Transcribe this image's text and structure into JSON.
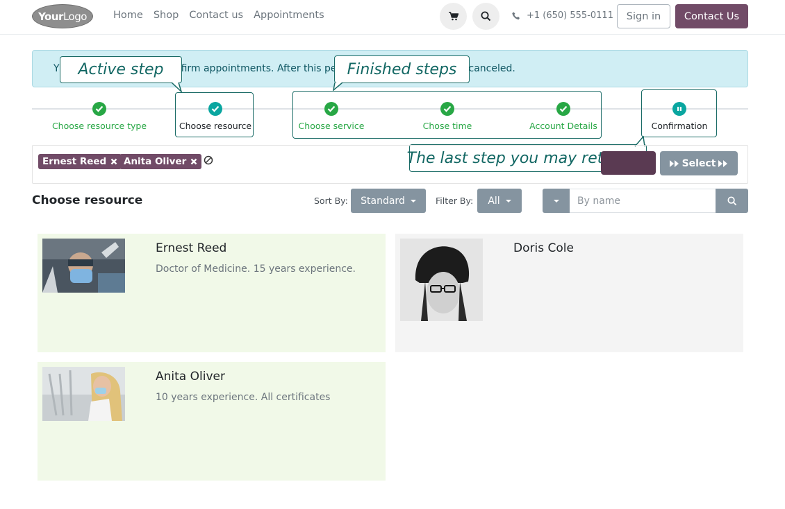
{
  "header": {
    "logo": {
      "part1": "Your",
      "part2": "Logo"
    },
    "nav": [
      "Home",
      "Shop",
      "Contact us",
      "Appointments"
    ],
    "phone": "+1 (650) 555-0111",
    "sign_in": "Sign in",
    "contact_us": "Contact Us",
    "icons": [
      "cart-icon",
      "search-icon",
      "phone-icon"
    ]
  },
  "alert": {
    "text_start": "Y",
    "text_mid": "firm appointments. After this pe",
    "text_end": "canceled."
  },
  "steps": [
    {
      "label": "Choose resource type",
      "state": "done"
    },
    {
      "label": "Choose resource",
      "state": "active"
    },
    {
      "label": "Choose service",
      "state": "done"
    },
    {
      "label": "Chose time",
      "state": "done"
    },
    {
      "label": "Account Details",
      "state": "done"
    },
    {
      "label": "Confirmation",
      "state": "active"
    }
  ],
  "annotations": {
    "active_step": "Active step",
    "finished_steps": "Finished steps",
    "last_step": "The last step you may return to"
  },
  "filter_bar": {
    "tags": [
      "Ernest Reed",
      "Anita Oliver"
    ],
    "select_label": "Select"
  },
  "section": {
    "title": "Choose resource",
    "sort_by_label": "Sort By:",
    "sort_value": "Standard",
    "filter_by_label": "Filter By:",
    "filter_value": "All",
    "search_placeholder": "By name"
  },
  "resources": [
    {
      "name": "Ernest Reed",
      "description": "Doctor of Medicine. 15 years experience.",
      "selected": true
    },
    {
      "name": "Doris Cole",
      "description": "",
      "selected": false
    },
    {
      "name": "Anita Oliver",
      "description": "10 years experience. All certificates",
      "selected": true
    }
  ],
  "colors": {
    "brand": "#714b67",
    "success": "#28a745",
    "active": "#0aa6a0",
    "annotation": "#126763",
    "secondary_btn": "#8594a0",
    "selected_card": "#f1f9e8",
    "info_alert": "#d0eef4"
  }
}
